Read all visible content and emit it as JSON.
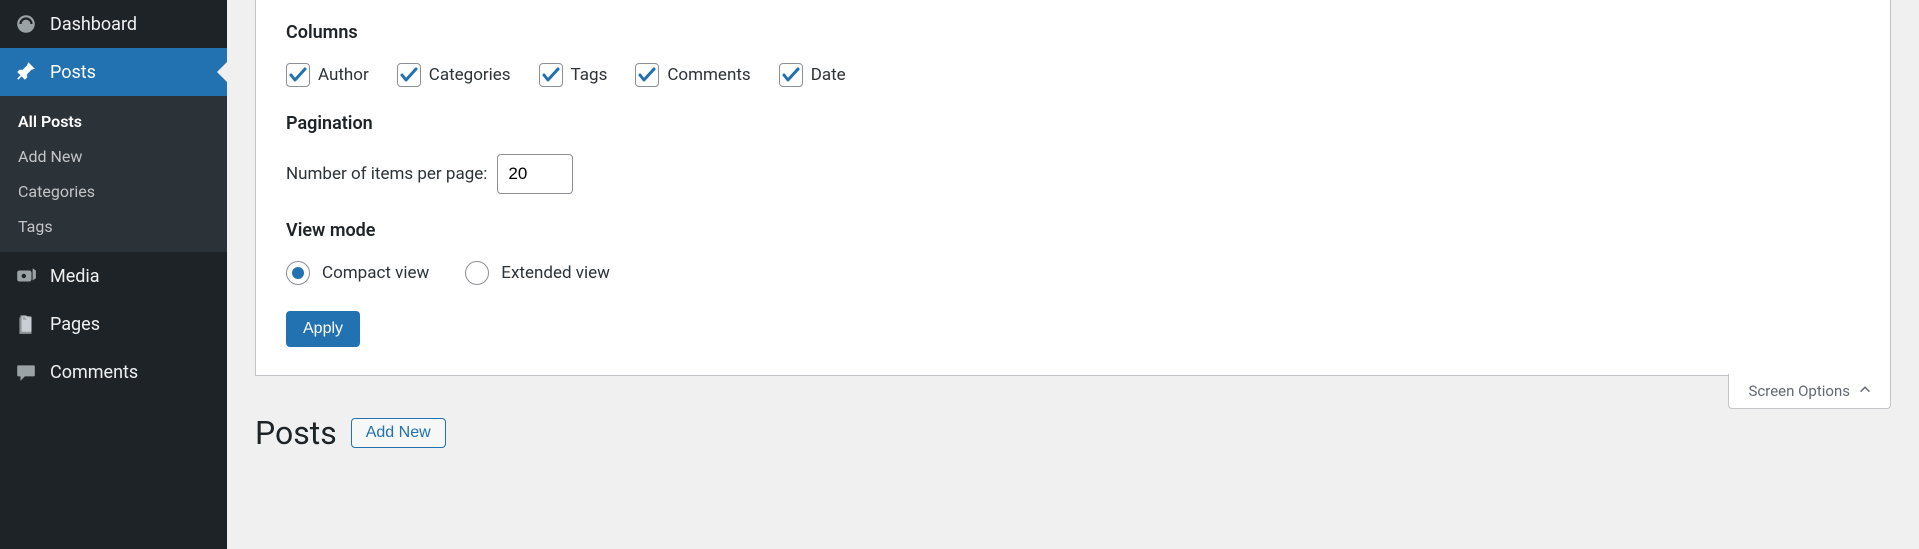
{
  "sidebar": {
    "dashboard": "Dashboard",
    "posts": "Posts",
    "media": "Media",
    "pages": "Pages",
    "comments": "Comments",
    "submenu": {
      "all_posts": "All Posts",
      "add_new": "Add New",
      "categories": "Categories",
      "tags": "Tags"
    }
  },
  "panel": {
    "columns_heading": "Columns",
    "columns": {
      "author": "Author",
      "categories": "Categories",
      "tags": "Tags",
      "comments": "Comments",
      "date": "Date"
    },
    "pagination_heading": "Pagination",
    "items_per_page_label": "Number of items per page:",
    "items_per_page_value": "20",
    "view_mode_heading": "View mode",
    "view": {
      "compact": "Compact view",
      "extended": "Extended view"
    },
    "apply": "Apply"
  },
  "screen_options_label": "Screen Options",
  "page": {
    "title": "Posts",
    "add_new": "Add New"
  },
  "colors": {
    "primary": "#2271b1"
  }
}
